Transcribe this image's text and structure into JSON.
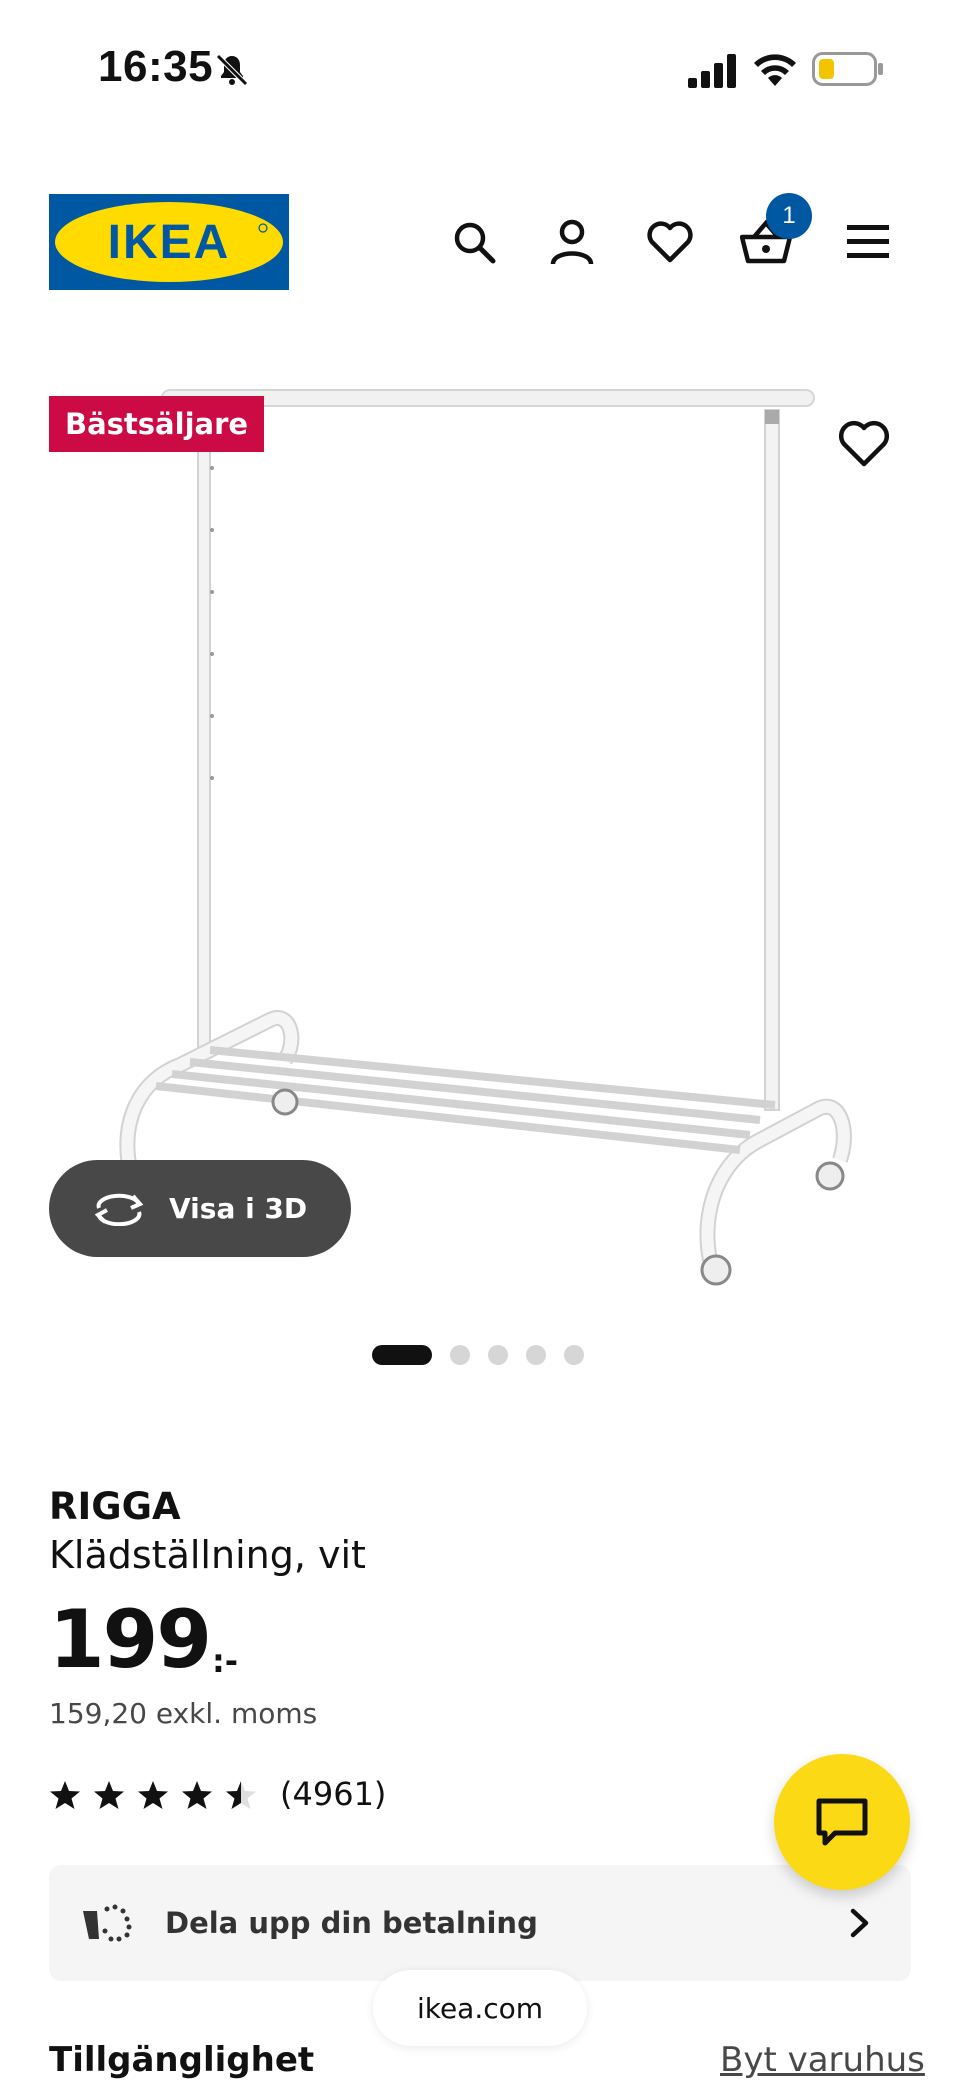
{
  "status_bar": {
    "time": "16:35",
    "icons": [
      "bell-muted-icon",
      "signal-icon",
      "wifi-icon",
      "battery-icon"
    ]
  },
  "header": {
    "logo_text": "IKEA",
    "icons": [
      "search-icon",
      "account-icon",
      "heart-icon",
      "cart-icon",
      "menu-icon"
    ],
    "cart_count": "1",
    "colors": {
      "logo_blue": "#0058a3",
      "logo_yellow": "#ffdb00",
      "badge_blue": "#0058a3"
    }
  },
  "gallery": {
    "badge": "Bästsäljare",
    "view_3d_label": "Visa i 3D",
    "dots_total": 5,
    "active_dot": 1
  },
  "product": {
    "name": "RIGGA",
    "description": "Klädställning, vit",
    "price": "199",
    "price_suffix": ":-",
    "price_ex_vat": "159,20 exkl. moms",
    "rating": 4.5,
    "review_count": "(4961)"
  },
  "payment": {
    "label": "Dela upp din betalning"
  },
  "browser": {
    "url": "ikea.com"
  },
  "availability": {
    "title": "Tillgänglighet",
    "change_store": "Byt varuhus"
  },
  "colors": {
    "badge_red": "#cc0a43",
    "chat_yellow": "#fbd914",
    "button_dark": "#484848"
  }
}
